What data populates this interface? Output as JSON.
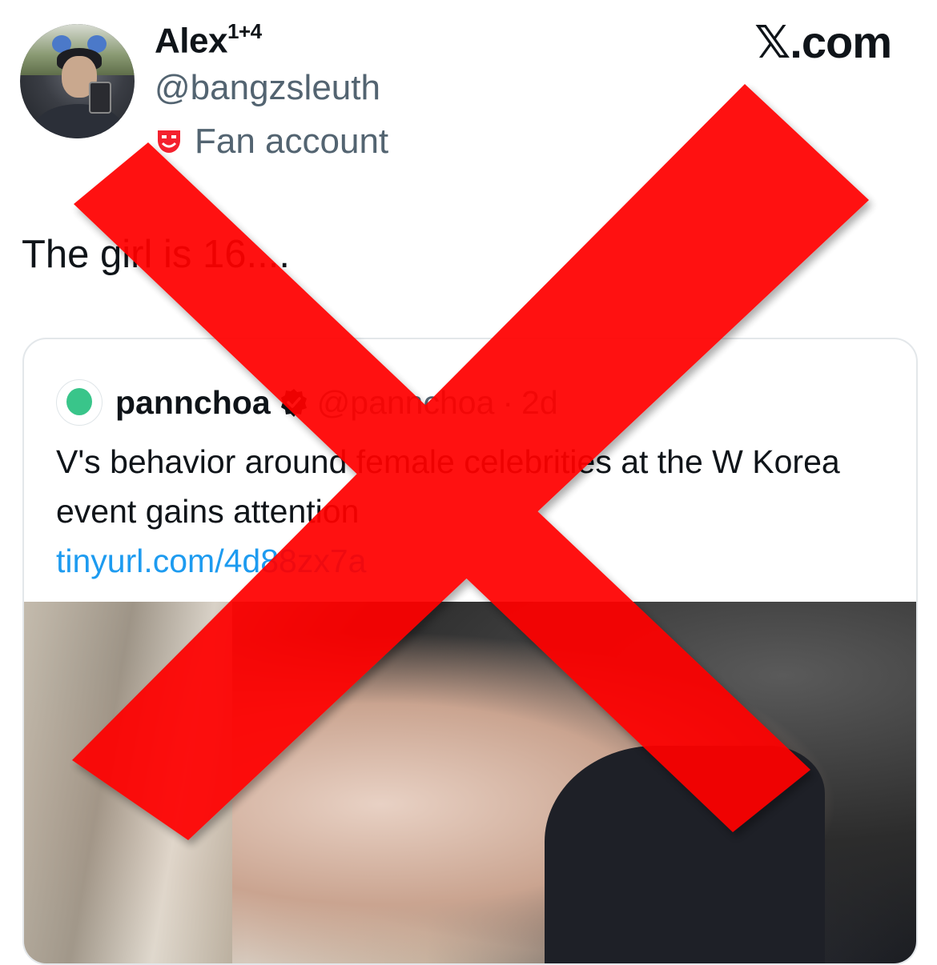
{
  "header": {
    "display_name": "Alex",
    "name_suffix": "1+4",
    "handle": "@bangzsleuth",
    "badge_label": "Fan account",
    "badge_icon": "theater-mask-icon",
    "brand": "𝕏.com"
  },
  "tweet": {
    "text": "The girl is 16...."
  },
  "quote": {
    "name": "pannchoa",
    "verified_icon": "verified-badge-icon",
    "handle": "@pannchoa",
    "separator": "·",
    "time": "2d",
    "text": "V's behavior around female celebrities at the W Korea event gains attention",
    "link": "tinyurl.com/4d88zx7a"
  },
  "overlay": {
    "icon": "red-x-icon",
    "color": "#ff0000"
  }
}
